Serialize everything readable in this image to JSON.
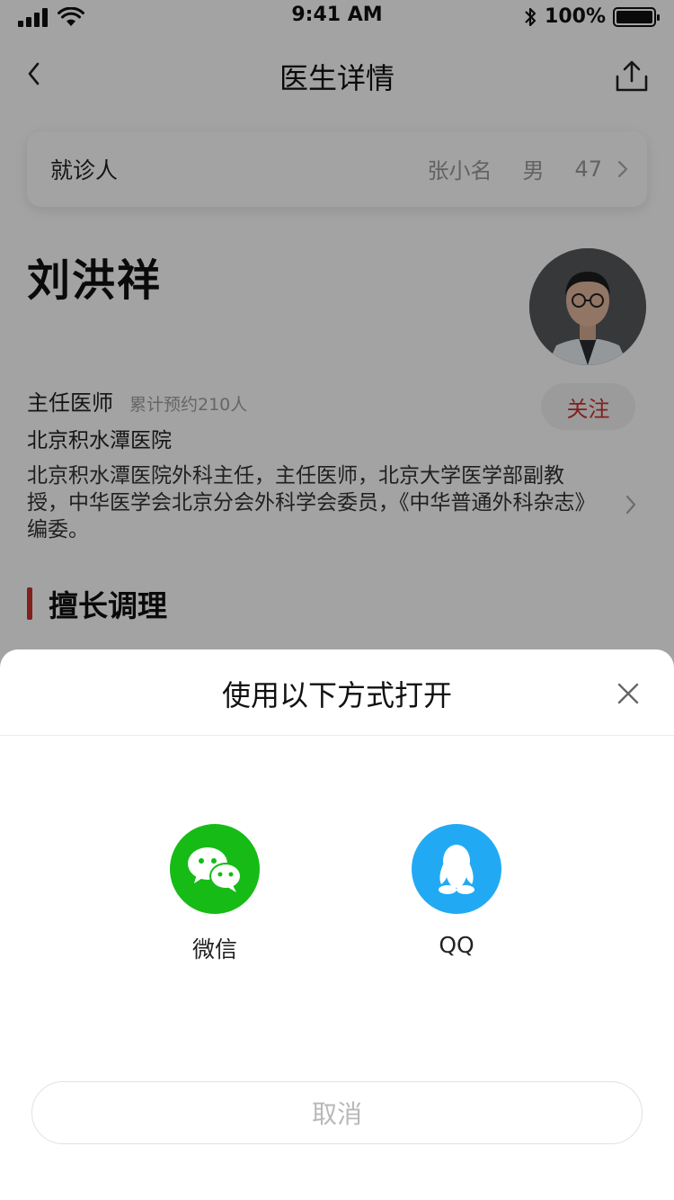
{
  "status": {
    "time": "9:41 AM",
    "battery": "100%"
  },
  "nav": {
    "title": "医生详情"
  },
  "patient": {
    "label": "就诊人",
    "name": "张小名",
    "gender": "男",
    "age": "47"
  },
  "doctor": {
    "name": "刘洪祥",
    "title": "主任医师",
    "appointments": "累计预约210人",
    "follow": "关注",
    "hospital": "北京积水潭医院",
    "bio": "北京积水潭医院外科主任，主任医师，北京大学医学部副教授，中华医学会北京分会外科学会委员，《中华普通外科杂志》编委。"
  },
  "section": {
    "title": "擅长调理"
  },
  "sheet": {
    "title": "使用以下方式打开",
    "options": [
      {
        "label": "微信",
        "icon": "wechat-icon",
        "color": "#16bb16"
      },
      {
        "label": "QQ",
        "icon": "qq-icon",
        "color": "#21aaf3"
      }
    ],
    "cancel": "取消"
  },
  "colors": {
    "accent": "#c8342f"
  }
}
